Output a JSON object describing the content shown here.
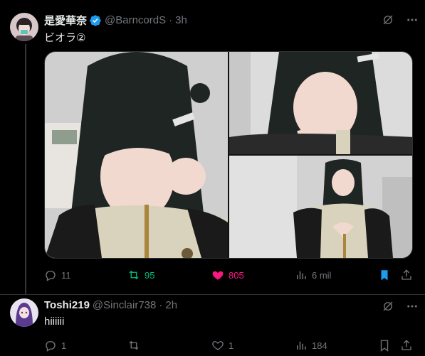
{
  "tweet": {
    "display_name": "是愛華奈",
    "handle": "@BarncordS",
    "separator": "·",
    "time": "3h",
    "text": "ビオラ②",
    "stats": {
      "replies": "11",
      "retweets": "95",
      "likes": "805",
      "views": "6 mil"
    },
    "colors": {
      "retweet": "#00ba7c",
      "like": "#f91880",
      "bookmark": "#1d9bf0",
      "verified": "#1d9bf0"
    }
  },
  "reply": {
    "display_name": "Toshi219",
    "handle": "@Sinclair738",
    "separator": "·",
    "time": "2h",
    "text": "hiiiiii",
    "stats": {
      "replies": "1",
      "retweets": "",
      "likes": "1",
      "views": "184"
    }
  },
  "icons": [
    "grok-icon",
    "more-icon",
    "reply-icon",
    "retweet-icon",
    "like-icon",
    "views-icon",
    "bookmark-icon",
    "share-icon",
    "verified-badge-icon"
  ]
}
